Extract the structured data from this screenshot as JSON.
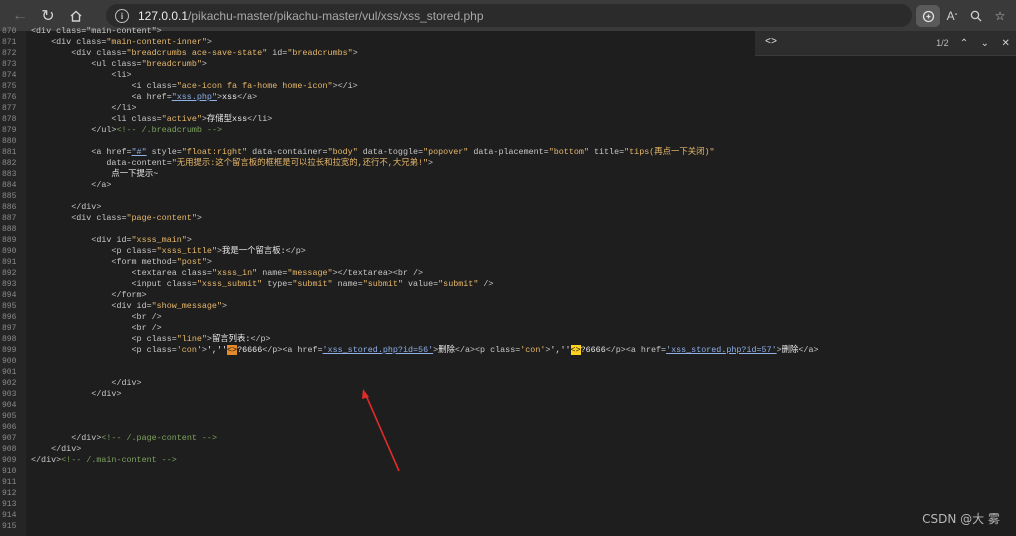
{
  "browser": {
    "url_host": "127.0.0.1",
    "url_path": "/pikachu-master/pikachu-master/vul/xss/xss_stored.php"
  },
  "find": {
    "query": "<>",
    "count": "1/2"
  },
  "watermark": "CSDN @大 雾",
  "lines": [
    {
      "n": "870",
      "segs": [
        [
          "tag",
          "<div class=\"main-content\">"
        ]
      ]
    },
    {
      "n": "871",
      "segs": [
        [
          "tag",
          "    <div class="
        ],
        [
          "av",
          "\"main-content-inner\""
        ],
        [
          "tag",
          ">"
        ]
      ]
    },
    {
      "n": "872",
      "segs": [
        [
          "tag",
          "        <div class="
        ],
        [
          "av",
          "\"breadcrumbs ace-save-state\""
        ],
        [
          "tag",
          " id="
        ],
        [
          "av",
          "\"breadcrumbs\""
        ],
        [
          "tag",
          ">"
        ]
      ]
    },
    {
      "n": "873",
      "segs": [
        [
          "tag",
          "            <ul class="
        ],
        [
          "av",
          "\"breadcrumb\""
        ],
        [
          "tag",
          ">"
        ]
      ]
    },
    {
      "n": "874",
      "segs": [
        [
          "tag",
          "                <li>"
        ]
      ]
    },
    {
      "n": "875",
      "segs": [
        [
          "tag",
          "                    <i class="
        ],
        [
          "av",
          "\"ace-icon fa fa-home home-icon\""
        ],
        [
          "tag",
          "></i>"
        ]
      ]
    },
    {
      "n": "876",
      "segs": [
        [
          "tag",
          "                    <a href="
        ],
        [
          "lk",
          "\"xss.php\""
        ],
        [
          "tag",
          ">"
        ],
        [
          "t",
          "xss"
        ],
        [
          "tag",
          "</a>"
        ]
      ]
    },
    {
      "n": "877",
      "segs": [
        [
          "tag",
          "                </li>"
        ]
      ]
    },
    {
      "n": "878",
      "segs": [
        [
          "tag",
          "                <li class="
        ],
        [
          "av",
          "\"active\""
        ],
        [
          "tag",
          ">"
        ],
        [
          "t",
          "存储型xss"
        ],
        [
          "tag",
          "</li>"
        ]
      ]
    },
    {
      "n": "879",
      "segs": [
        [
          "tag",
          "            </ul>"
        ],
        [
          "cm",
          "<!-- /.breadcrumb -->"
        ]
      ]
    },
    {
      "n": "880",
      "segs": []
    },
    {
      "n": "881",
      "segs": [
        [
          "tag",
          "            <a href="
        ],
        [
          "lk",
          "\"#\""
        ],
        [
          "tag",
          " style="
        ],
        [
          "av",
          "\"float:right\""
        ],
        [
          "tag",
          " data-container="
        ],
        [
          "av",
          "\"body\""
        ],
        [
          "tag",
          " data-toggle="
        ],
        [
          "av",
          "\"popover\""
        ],
        [
          "tag",
          " data-placement="
        ],
        [
          "av",
          "\"bottom\""
        ],
        [
          "tag",
          " title="
        ],
        [
          "av",
          "\"tips(再点一下关闭)\""
        ]
      ]
    },
    {
      "n": "882",
      "segs": [
        [
          "tag",
          "               data-content="
        ],
        [
          "av",
          "\"无用提示:这个留言板的框框是可以拉长和拉宽的,还行不,大兄弟!\""
        ],
        [
          "tag",
          ">"
        ]
      ]
    },
    {
      "n": "883",
      "segs": [
        [
          "t",
          "                点一下提示~"
        ]
      ]
    },
    {
      "n": "884",
      "segs": [
        [
          "tag",
          "            </a>"
        ]
      ]
    },
    {
      "n": "885",
      "segs": []
    },
    {
      "n": "886",
      "segs": [
        [
          "tag",
          "        </div>"
        ]
      ]
    },
    {
      "n": "887",
      "segs": [
        [
          "tag",
          "        <div class="
        ],
        [
          "av",
          "\"page-content\""
        ],
        [
          "tag",
          ">"
        ]
      ]
    },
    {
      "n": "888",
      "segs": []
    },
    {
      "n": "889",
      "segs": [
        [
          "tag",
          "            <div id="
        ],
        [
          "av",
          "\"xsss_main\""
        ],
        [
          "tag",
          ">"
        ]
      ]
    },
    {
      "n": "890",
      "segs": [
        [
          "tag",
          "                <p class="
        ],
        [
          "av",
          "\"xsss_title\""
        ],
        [
          "tag",
          ">"
        ],
        [
          "t",
          "我是一个留言板:"
        ],
        [
          "tag",
          "</p>"
        ]
      ]
    },
    {
      "n": "891",
      "segs": [
        [
          "tag",
          "                <form method="
        ],
        [
          "av",
          "\"post\""
        ],
        [
          "tag",
          ">"
        ]
      ]
    },
    {
      "n": "892",
      "segs": [
        [
          "tag",
          "                    <textarea class="
        ],
        [
          "av",
          "\"xsss_in\""
        ],
        [
          "tag",
          " name="
        ],
        [
          "av",
          "\"message\""
        ],
        [
          "tag",
          "></textarea><br />"
        ]
      ]
    },
    {
      "n": "893",
      "segs": [
        [
          "tag",
          "                    <input class="
        ],
        [
          "av",
          "\"xsss_submit\""
        ],
        [
          "tag",
          " type="
        ],
        [
          "av",
          "\"submit\""
        ],
        [
          "tag",
          " name="
        ],
        [
          "av",
          "\"submit\""
        ],
        [
          "tag",
          " value="
        ],
        [
          "av",
          "\"submit\""
        ],
        [
          "tag",
          " />"
        ]
      ]
    },
    {
      "n": "894",
      "segs": [
        [
          "tag",
          "                </form>"
        ]
      ]
    },
    {
      "n": "895",
      "segs": [
        [
          "tag",
          "                <div id="
        ],
        [
          "av",
          "\"show_message\""
        ],
        [
          "tag",
          ">"
        ]
      ]
    },
    {
      "n": "896",
      "segs": [
        [
          "tag",
          "                    <br />"
        ]
      ]
    },
    {
      "n": "897",
      "segs": [
        [
          "tag",
          "                    <br />"
        ]
      ]
    },
    {
      "n": "898",
      "segs": [
        [
          "tag",
          "                    <p class="
        ],
        [
          "av",
          "\"line\""
        ],
        [
          "tag",
          ">"
        ],
        [
          "t",
          "留言列表:"
        ],
        [
          "tag",
          "</p>"
        ]
      ]
    },
    {
      "n": "899",
      "segs": [
        [
          "tag",
          "                    <p class="
        ],
        [
          "av",
          "'con'"
        ],
        [
          "tag",
          ">"
        ],
        [
          "t",
          "',''"
        ],
        [
          "hlo",
          "<>"
        ],
        [
          "t",
          "?6666"
        ],
        [
          "tag",
          "</p><a href="
        ],
        [
          "lk",
          "'xss_stored.php?id=56'"
        ],
        [
          "tag",
          ">"
        ],
        [
          "t",
          "删除"
        ],
        [
          "tag",
          "</a><p class="
        ],
        [
          "av",
          "'con'"
        ],
        [
          "tag",
          ">"
        ],
        [
          "t",
          "',''"
        ],
        [
          "hl",
          "<>"
        ],
        [
          "t",
          "?6666"
        ],
        [
          "tag",
          "</p><a href="
        ],
        [
          "lk",
          "'xss_stored.php?id=57'"
        ],
        [
          "tag",
          ">"
        ],
        [
          "t",
          "删除"
        ],
        [
          "tag",
          "</a>"
        ]
      ]
    },
    {
      "n": "900",
      "segs": []
    },
    {
      "n": "901",
      "segs": []
    },
    {
      "n": "902",
      "segs": [
        [
          "tag",
          "                </div>"
        ]
      ]
    },
    {
      "n": "903",
      "segs": [
        [
          "tag",
          "            </div>"
        ]
      ]
    },
    {
      "n": "904",
      "segs": []
    },
    {
      "n": "905",
      "segs": []
    },
    {
      "n": "906",
      "segs": []
    },
    {
      "n": "907",
      "segs": [
        [
          "tag",
          "        </div>"
        ],
        [
          "cm",
          "<!-- /.page-content -->"
        ]
      ]
    },
    {
      "n": "908",
      "segs": [
        [
          "tag",
          "    </div>"
        ]
      ]
    },
    {
      "n": "909",
      "segs": [
        [
          "tag",
          "</div>"
        ],
        [
          "cm",
          "<!-- /.main-content -->"
        ]
      ]
    },
    {
      "n": "910",
      "segs": []
    },
    {
      "n": "911",
      "segs": []
    },
    {
      "n": "912",
      "segs": []
    },
    {
      "n": "913",
      "segs": []
    },
    {
      "n": "914",
      "segs": []
    },
    {
      "n": "915",
      "segs": []
    }
  ]
}
